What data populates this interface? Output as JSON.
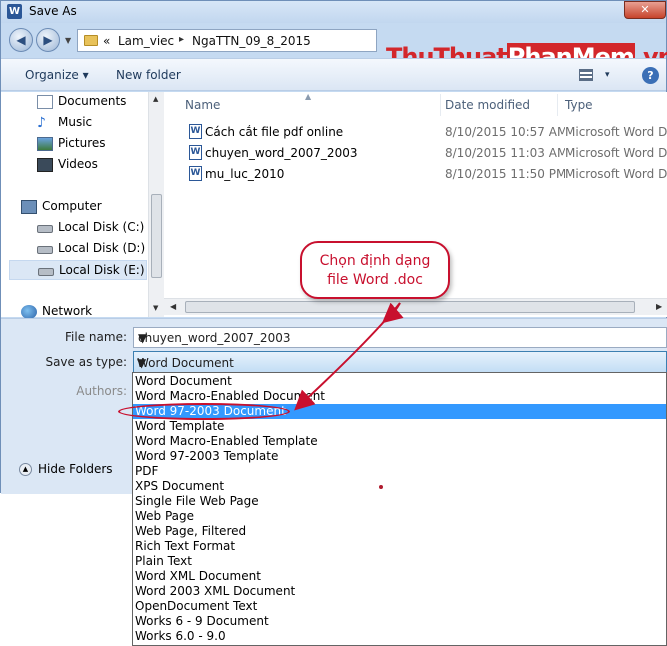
{
  "window": {
    "title": "Save As",
    "app_icon": "W",
    "close_label": "✕"
  },
  "address": {
    "overflow": "«",
    "crumbs": [
      "Lam_viec",
      "NgaTTN_09_8_2015"
    ],
    "sep": "▸"
  },
  "watermark": {
    "part1": "Thu",
    "part2": "Thuat",
    "part3": "PhanMem",
    "part4": ".vn"
  },
  "toolbar": {
    "organize": "Organize ▾",
    "new_folder": "New folder",
    "view_menu": "▾",
    "help": "?"
  },
  "navpane": {
    "items": [
      {
        "label": "Documents",
        "icon": "documents-icon"
      },
      {
        "label": "Music",
        "icon": "music-icon"
      },
      {
        "label": "Pictures",
        "icon": "pictures-icon"
      },
      {
        "label": "Videos",
        "icon": "videos-icon"
      },
      {
        "label": "Computer",
        "icon": "computer-icon"
      },
      {
        "label": "Local Disk (C:)",
        "icon": "disk-icon"
      },
      {
        "label": "Local Disk (D:)",
        "icon": "disk-icon"
      },
      {
        "label": "Local Disk (E:)",
        "icon": "disk-icon",
        "selected": true
      },
      {
        "label": "Network",
        "icon": "network-icon"
      }
    ]
  },
  "files": {
    "columns": [
      "Name",
      "Date modified",
      "Type"
    ],
    "rows": [
      {
        "name": "Cách cắt file pdf online",
        "date": "8/10/2015 10:57 AM",
        "type": "Microsoft Word D..."
      },
      {
        "name": "chuyen_word_2007_2003",
        "date": "8/10/2015 11:03 AM",
        "type": "Microsoft Word D..."
      },
      {
        "name": "mu_luc_2010",
        "date": "8/10/2015 11:50 PM",
        "type": "Microsoft Word D..."
      }
    ]
  },
  "form": {
    "file_name_label": "File name:",
    "file_name_value": "chuyen_word_2007_2003",
    "save_type_label": "Save as type:",
    "save_type_value": "Word Document",
    "authors_label": "Authors:",
    "hide_folders": "Hide Folders"
  },
  "save_type_options": [
    "Word Document",
    "Word Macro-Enabled Document",
    "Word 97-2003 Document",
    "Word Template",
    "Word Macro-Enabled Template",
    "Word 97-2003 Template",
    "PDF",
    "XPS Document",
    "Single File Web Page",
    "Web Page",
    "Web Page, Filtered",
    "Rich Text Format",
    "Plain Text",
    "Word XML Document",
    "Word 2003 XML Document",
    "OpenDocument Text",
    "Works 6 - 9 Document",
    "Works 6.0 - 9.0"
  ],
  "highlighted_option": "Word 97-2003 Document",
  "annotation": {
    "line1": "Chọn định dạng",
    "line2": "file Word .doc",
    "color": "#c8102e"
  }
}
